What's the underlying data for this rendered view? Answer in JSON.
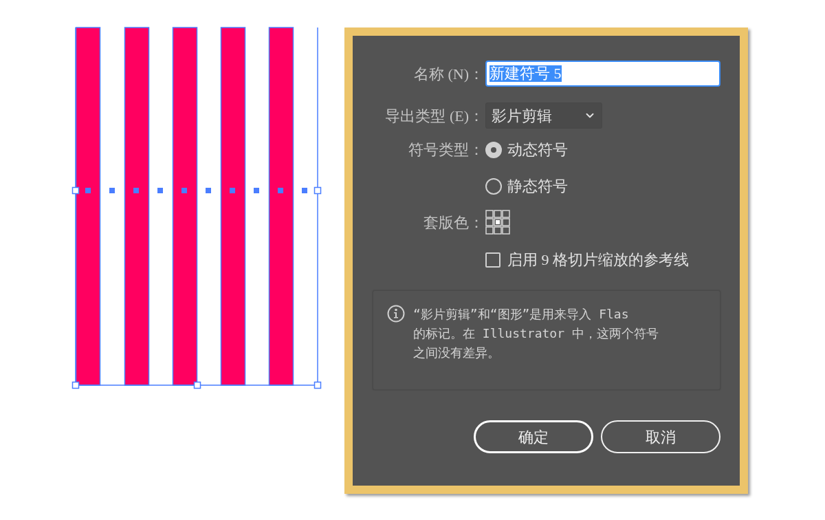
{
  "dialog": {
    "name_field": {
      "label": "名称 (N)：",
      "value": "新建符号 5",
      "text_selected": true
    },
    "export_type": {
      "label": "导出类型 (E)：",
      "value": "影片剪辑"
    },
    "symbol_type": {
      "label": "符号类型：",
      "options": [
        {
          "label": "动态符号",
          "selected": true
        },
        {
          "label": "静态符号",
          "selected": false
        }
      ]
    },
    "registration": {
      "label": "套版色："
    },
    "nine_slice": {
      "label": "启用 9 格切片缩放的参考线",
      "checked": false
    },
    "info_lines": [
      "“影片剪辑”和“图形”是用来导入 Flas",
      "的标记。在 Illustrator 中，这两个符号",
      "之间没有差异。"
    ],
    "buttons": [
      {
        "label": "确定",
        "default": true
      },
      {
        "label": "取消",
        "default": false
      }
    ]
  }
}
